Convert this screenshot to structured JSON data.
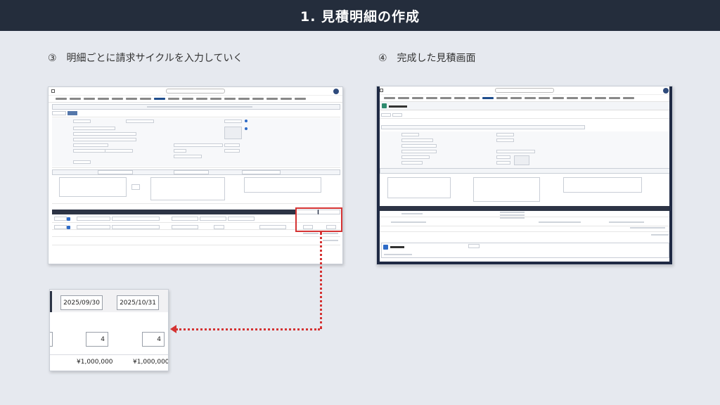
{
  "header": {
    "title": "1. 見積明細の作成"
  },
  "steps": {
    "left": "③　明細ごとに請求サイクルを入力していく",
    "right": "④　完成した見積画面"
  },
  "zoom": {
    "date_start": "2025/09/30",
    "date_end": "2025/10/31",
    "qty_1": "4",
    "qty_2": "4",
    "amount_1": "¥1,000,000",
    "amount_2": "¥1,000,000"
  },
  "colors": {
    "title_bar": "#242d3c",
    "background": "#e6e9ef",
    "highlight": "#d53333"
  }
}
